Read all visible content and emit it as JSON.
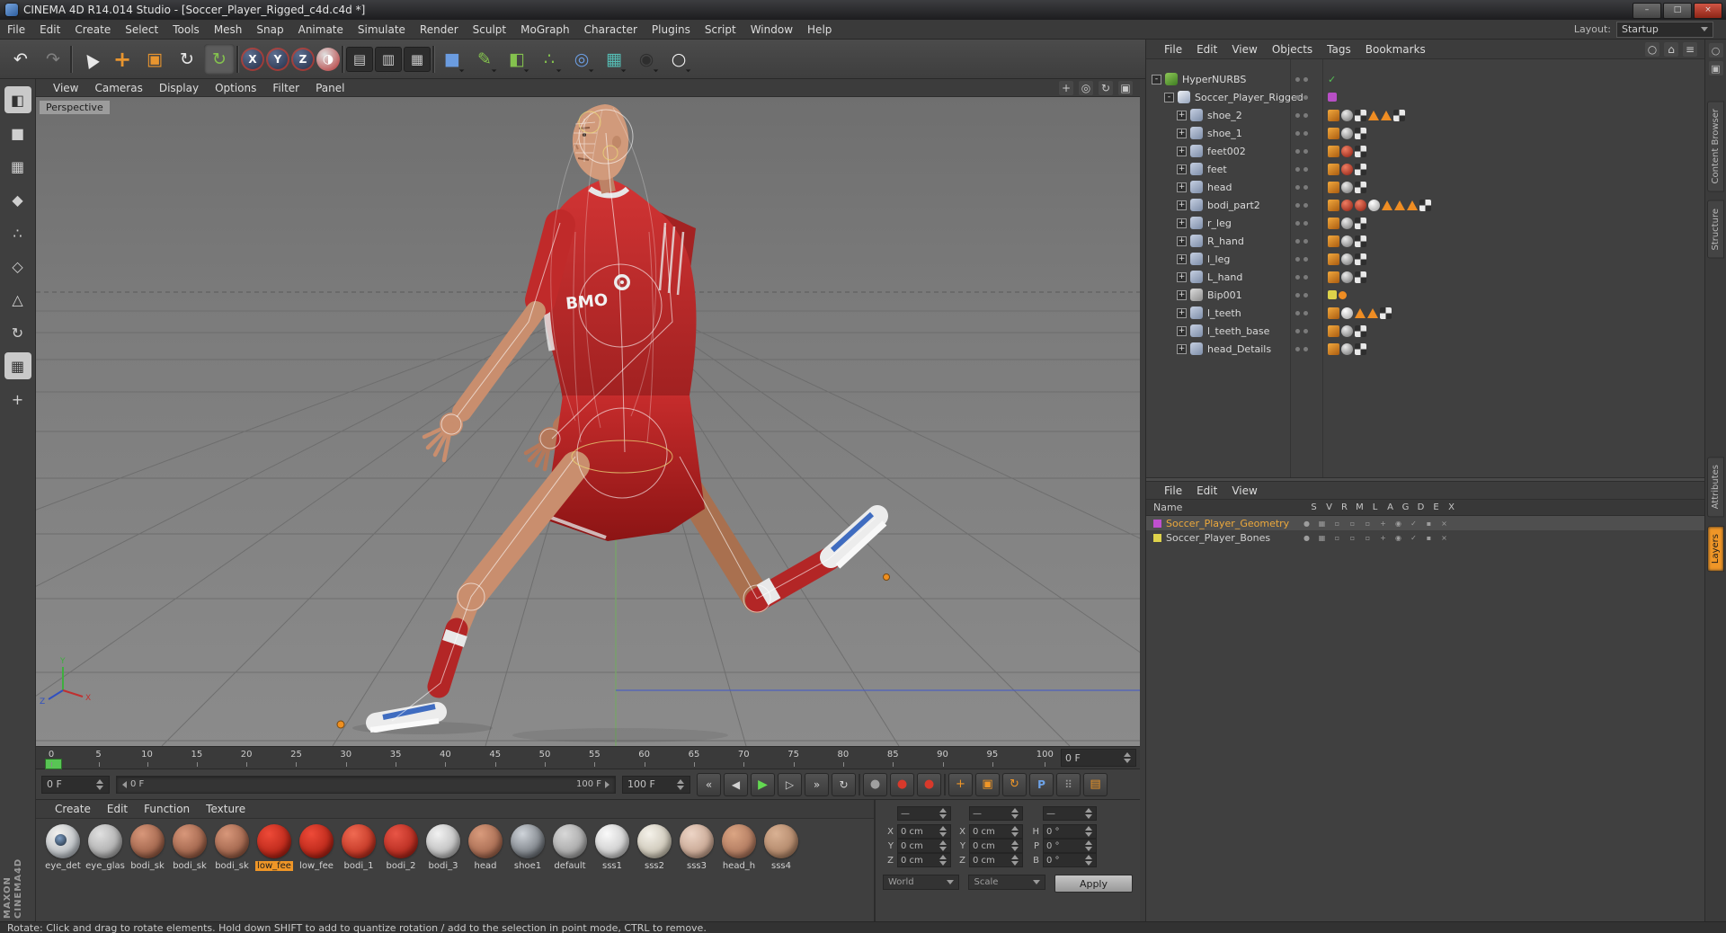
{
  "window": {
    "title": "CINEMA 4D R14.014 Studio - [Soccer_Player_Rigged_c4d.c4d *]",
    "minimize": "–",
    "restore": "□",
    "close": "×"
  },
  "branding": {
    "maxon": "MAXON",
    "cinema": "CINEMA4D"
  },
  "menubar": {
    "items": [
      "File",
      "Edit",
      "Create",
      "Select",
      "Tools",
      "Mesh",
      "Snap",
      "Animate",
      "Simulate",
      "Render",
      "Sculpt",
      "MoGraph",
      "Character",
      "Plugins",
      "Script",
      "Window",
      "Help"
    ],
    "layout_label": "Layout:",
    "layout_value": "Startup"
  },
  "toolbar": {
    "items": [
      {
        "n": "undo-icon",
        "g": "↶",
        "cls": "c-light"
      },
      {
        "n": "redo-icon",
        "g": "↷",
        "cls": "c-dim"
      },
      {
        "n": "toolbar-separator",
        "g": "",
        "cls": "sep"
      },
      {
        "n": "live-selection-icon",
        "g": "▲",
        "cls": "c-light cursor"
      },
      {
        "n": "move-tool-icon",
        "g": "+",
        "cls": "c-orange big"
      },
      {
        "n": "scale-tool-icon",
        "g": "▣",
        "cls": "c-orange"
      },
      {
        "n": "rotate-tool-icon",
        "g": "↻",
        "cls": "c-light"
      },
      {
        "n": "last-tool-icon",
        "g": "↻",
        "cls": "c-green active"
      },
      {
        "n": "toolbar-separator",
        "g": "",
        "cls": "sep"
      },
      {
        "n": "lock-x-axis-icon",
        "g": "X",
        "cls": "axis"
      },
      {
        "n": "lock-y-axis-icon",
        "g": "Y",
        "cls": "axis"
      },
      {
        "n": "lock-z-axis-icon",
        "g": "Z",
        "cls": "axis"
      },
      {
        "n": "coordinate-system-icon",
        "g": "◑",
        "cls": "globe"
      },
      {
        "n": "toolbar-separator",
        "g": "",
        "cls": "sep"
      },
      {
        "n": "render-view-icon",
        "g": "▤",
        "cls": "film"
      },
      {
        "n": "render-region-icon",
        "g": "▥",
        "cls": "film"
      },
      {
        "n": "render-settings-icon",
        "g": "▦",
        "cls": "film"
      },
      {
        "n": "toolbar-separator",
        "g": "",
        "cls": "sep"
      },
      {
        "n": "add-cube-icon",
        "g": "■",
        "cls": "c-blue dd"
      },
      {
        "n": "add-spline-icon",
        "g": "✎",
        "cls": "c-green dd"
      },
      {
        "n": "add-nurbs-icon",
        "g": "◧",
        "cls": "c-green dd"
      },
      {
        "n": "add-modeling-icon",
        "g": "∴",
        "cls": "c-green dd"
      },
      {
        "n": "add-deformer-icon",
        "g": "◎",
        "cls": "c-blue dd"
      },
      {
        "n": "add-environment-icon",
        "g": "▦",
        "cls": "c-teal dd"
      },
      {
        "n": "add-camera-icon",
        "g": "◉",
        "cls": "c-dark dd"
      },
      {
        "n": "add-light-icon",
        "g": "○",
        "cls": "c-white dd"
      }
    ]
  },
  "left_tools": {
    "items": [
      {
        "n": "make-editable-icon",
        "g": "◧",
        "cls": "pale"
      },
      {
        "n": "model-mode-icon",
        "g": "■",
        "cls": "c-blue"
      },
      {
        "n": "texture-mode-icon",
        "g": "▦",
        "cls": "c-light"
      },
      {
        "n": "workplane-mode-icon",
        "g": "◆",
        "cls": "c-orange"
      },
      {
        "n": "points-mode-icon",
        "g": "∴",
        "cls": "c-light"
      },
      {
        "n": "edges-mode-icon",
        "g": "◇",
        "cls": "c-light"
      },
      {
        "n": "polygons-mode-icon",
        "g": "△",
        "cls": "c-orange"
      },
      {
        "n": "tweak-mode-icon",
        "g": "↻",
        "cls": "c-orange"
      },
      {
        "n": "texture-edit-icon",
        "g": "▦",
        "cls": "pale"
      },
      {
        "n": "axis-mode-icon",
        "g": "+",
        "cls": "c-orange"
      }
    ]
  },
  "viewport": {
    "menus": [
      "View",
      "Cameras",
      "Display",
      "Options",
      "Filter",
      "Panel"
    ],
    "corner_icons": [
      {
        "n": "pan-view-icon",
        "g": "+"
      },
      {
        "n": "zoom-view-icon",
        "g": "◎"
      },
      {
        "n": "rotate-view-icon",
        "g": "↻"
      },
      {
        "n": "toggle-view-icon",
        "g": "▣"
      }
    ],
    "label": "Perspective",
    "jersey_text": "BMO"
  },
  "object_manager": {
    "menus": [
      "File",
      "Edit",
      "View",
      "Objects",
      "Tags",
      "Bookmarks"
    ],
    "corner_icons": [
      {
        "n": "search-icon",
        "g": "○"
      },
      {
        "n": "home-icon",
        "g": "⌂"
      },
      {
        "n": "list-icon",
        "g": "≡"
      }
    ],
    "rows": [
      {
        "exp": "-",
        "cls": "lvl0",
        "icon": "ico-hn",
        "name": "HyperNURBS",
        "tags": [
          "check-green"
        ]
      },
      {
        "exp": "-",
        "cls": "lvl1",
        "icon": "ico-null",
        "name": "Soccer_Player_Rigged",
        "tags": [
          "layer-purple"
        ]
      },
      {
        "exp": "+",
        "cls": "lvl2",
        "icon": "ico-mesh",
        "name": "shoe_2",
        "tags": [
          "weight",
          "phong",
          "checker",
          "tri",
          "tri",
          "checker"
        ]
      },
      {
        "exp": "+",
        "cls": "lvl2",
        "icon": "ico-mesh",
        "name": "shoe_1",
        "tags": [
          "weight",
          "phong",
          "checker"
        ]
      },
      {
        "exp": "+",
        "cls": "lvl2",
        "icon": "ico-mesh",
        "name": "feet002",
        "tags": [
          "weight",
          "skinred",
          "checker"
        ]
      },
      {
        "exp": "+",
        "cls": "lvl2",
        "icon": "ico-mesh",
        "name": "feet",
        "tags": [
          "weight",
          "skinred",
          "checker"
        ]
      },
      {
        "exp": "+",
        "cls": "lvl2",
        "icon": "ico-mesh",
        "name": "head",
        "tags": [
          "weight",
          "phong",
          "checker"
        ]
      },
      {
        "exp": "+",
        "cls": "lvl2",
        "icon": "ico-mesh",
        "name": "bodi_part2",
        "tags": [
          "weight",
          "skinred",
          "skinred",
          "ballwhite",
          "tri",
          "tri",
          "tri",
          "checker"
        ]
      },
      {
        "exp": "+",
        "cls": "lvl2",
        "icon": "ico-mesh",
        "name": "r_leg",
        "tags": [
          "weight",
          "phong",
          "checker"
        ]
      },
      {
        "exp": "+",
        "cls": "lvl2",
        "icon": "ico-mesh",
        "name": "R_hand",
        "tags": [
          "weight",
          "phong",
          "checker"
        ]
      },
      {
        "exp": "+",
        "cls": "lvl2",
        "icon": "ico-mesh",
        "name": "l_leg",
        "tags": [
          "weight",
          "phong",
          "checker"
        ]
      },
      {
        "exp": "+",
        "cls": "lvl2",
        "icon": "ico-mesh",
        "name": "L_hand",
        "tags": [
          "weight",
          "phong",
          "checker"
        ]
      },
      {
        "exp": "+",
        "cls": "lvl2",
        "icon": "ico-bone",
        "name": "Bip001",
        "tags": [
          "layer-yellow",
          "dot-orange"
        ]
      },
      {
        "exp": "+",
        "cls": "lvl2",
        "icon": "ico-mesh",
        "name": "l_teeth",
        "tags": [
          "weight",
          "ballwhite",
          "tri",
          "tri",
          "checker"
        ]
      },
      {
        "exp": "+",
        "cls": "lvl2",
        "icon": "ico-mesh",
        "name": "l_teeth_base",
        "tags": [
          "weight",
          "phong",
          "checker"
        ]
      },
      {
        "exp": "+",
        "cls": "lvl2",
        "icon": "ico-mesh",
        "name": "head_Details",
        "tags": [
          "weight",
          "phong",
          "checker"
        ]
      }
    ]
  },
  "layer_manager": {
    "menus": [
      "File",
      "Edit",
      "View"
    ],
    "name_header": "Name",
    "columns": [
      "S",
      "V",
      "R",
      "M",
      "L",
      "A",
      "G",
      "D",
      "E",
      "X"
    ],
    "rows": [
      {
        "color": "#c050d0",
        "name": "Soccer_Player_Geometry",
        "sel": "sel",
        "cells": [
          "●",
          "▦",
          "▫",
          "▫",
          "▫",
          "+",
          "◉",
          "✓",
          "▪",
          "×"
        ]
      },
      {
        "color": "#ded24b",
        "name": "Soccer_Player_Bones",
        "cells": [
          "●",
          "▦",
          "▫",
          "▫",
          "▫",
          "+",
          "◉",
          "✓",
          "▪",
          "×"
        ]
      }
    ]
  },
  "right_strip": {
    "top_icons": [
      {
        "n": "search-icon",
        "g": "○"
      },
      {
        "n": "pin-icon",
        "g": "▣"
      }
    ],
    "tabs": [
      {
        "label": "Content Browser",
        "cls": "t1"
      },
      {
        "label": "Structure",
        "cls": "t2"
      },
      {
        "label": "Attributes",
        "cls": "t3"
      },
      {
        "label": "Layers",
        "cls": "t4 active"
      }
    ]
  },
  "timeline": {
    "ticks": [
      "0",
      "5",
      "10",
      "15",
      "20",
      "25",
      "30",
      "35",
      "40",
      "45",
      "50",
      "55",
      "60",
      "65",
      "70",
      "75",
      "80",
      "85",
      "90",
      "95",
      "100"
    ],
    "ruler_frame": "0 F",
    "current_frame": "0 F",
    "range_start": "0 F",
    "range_end": "100 F",
    "end_frame": "100 F",
    "buttons": [
      {
        "n": "goto-start-button",
        "g": "«",
        "cls": ""
      },
      {
        "n": "prev-frame-button",
        "g": "◀",
        "cls": ""
      },
      {
        "n": "play-button",
        "g": "▶",
        "cls": "play"
      },
      {
        "n": "next-frame-button",
        "g": "▷",
        "cls": ""
      },
      {
        "n": "goto-end-button",
        "g": "»",
        "cls": ""
      },
      {
        "n": "loop-button",
        "g": "↻",
        "cls": ""
      },
      {
        "n": "transport-separator",
        "g": "",
        "cls": "sep"
      },
      {
        "n": "record-button",
        "g": "●",
        "cls": "rec-gray"
      },
      {
        "n": "keyframe-record-button",
        "g": "●",
        "cls": "rec-red"
      },
      {
        "n": "autokey-record-button",
        "g": "●",
        "cls": "rec-red"
      },
      {
        "n": "transport-separator",
        "g": "",
        "cls": "sep"
      },
      {
        "n": "set-key-button",
        "g": "+",
        "cls": "orange"
      },
      {
        "n": "key-selection-button",
        "g": "▣",
        "cls": "orange"
      },
      {
        "n": "autokey-toggle-button",
        "g": "↻",
        "cls": "orange"
      },
      {
        "n": "powerslider-button",
        "g": "P",
        "cls": "blue"
      },
      {
        "n": "snap-grid-button",
        "g": "⠿",
        "cls": "dim"
      },
      {
        "n": "timeline-options-button",
        "g": "▤",
        "cls": "orange"
      }
    ]
  },
  "materials": {
    "menus": [
      "Create",
      "Edit",
      "Function",
      "Texture"
    ],
    "items": [
      {
        "name": "eye_det",
        "c1": "#f2f1ee",
        "c2": "#9ba3ac",
        "cls": "eye"
      },
      {
        "name": "eye_glas",
        "c1": "#e0e0e0",
        "c2": "#8f8f8f"
      },
      {
        "name": "bodi_sk",
        "c1": "#d8977a",
        "c2": "#7e4630"
      },
      {
        "name": "bodi_sk",
        "c1": "#d8977a",
        "c2": "#7e4630"
      },
      {
        "name": "bodi_sk",
        "c1": "#d8977a",
        "c2": "#7e4630"
      },
      {
        "name": "low_fee",
        "c1": "#ee4a38",
        "c2": "#9c1408",
        "sel": "sel"
      },
      {
        "name": "low_fee",
        "c1": "#ee4a38",
        "c2": "#9c1408"
      },
      {
        "name": "bodi_1",
        "c1": "#f06a52",
        "c2": "#a81a0c"
      },
      {
        "name": "bodi_2",
        "c1": "#e85546",
        "c2": "#9a150a"
      },
      {
        "name": "bodi_3",
        "c1": "#f2f2f2",
        "c2": "#9d9d9d"
      },
      {
        "name": "head",
        "c1": "#d99b7c",
        "c2": "#8a503a"
      },
      {
        "name": "shoe1",
        "c1": "#cfd4da",
        "c2": "#4a4f55"
      },
      {
        "name": "default",
        "c1": "#d8d8d8",
        "c2": "#8a8a8a"
      },
      {
        "name": "sss1",
        "c1": "#fafafa",
        "c2": "#b0b0b0"
      },
      {
        "name": "sss2",
        "c1": "#f5f2ea",
        "c2": "#b3ab98"
      },
      {
        "name": "sss3",
        "c1": "#edd5c6",
        "c2": "#b08a74"
      },
      {
        "name": "head_h",
        "c1": "#dba583",
        "c2": "#96604a"
      },
      {
        "name": "sss4",
        "c1": "#d9b193",
        "c2": "#9a6f52"
      }
    ]
  },
  "coords": {
    "top": [
      "—",
      "—",
      "—"
    ],
    "rows": [
      {
        "a": "X",
        "av": "0 cm",
        "b": "X",
        "bv": "0 cm",
        "c": "H",
        "cv": "0 °"
      },
      {
        "a": "Y",
        "av": "0 cm",
        "b": "Y",
        "bv": "0 cm",
        "c": "P",
        "cv": "0 °"
      },
      {
        "a": "Z",
        "av": "0 cm",
        "b": "Z",
        "bv": "0 cm",
        "c": "B",
        "cv": "0 °"
      }
    ],
    "world": "World",
    "scale": "Scale",
    "apply": "Apply"
  },
  "statusbar": {
    "text": "Rotate: Click and drag to rotate elements. Hold down SHIFT to add to quantize rotation / add to the selection in point mode, CTRL to remove."
  }
}
